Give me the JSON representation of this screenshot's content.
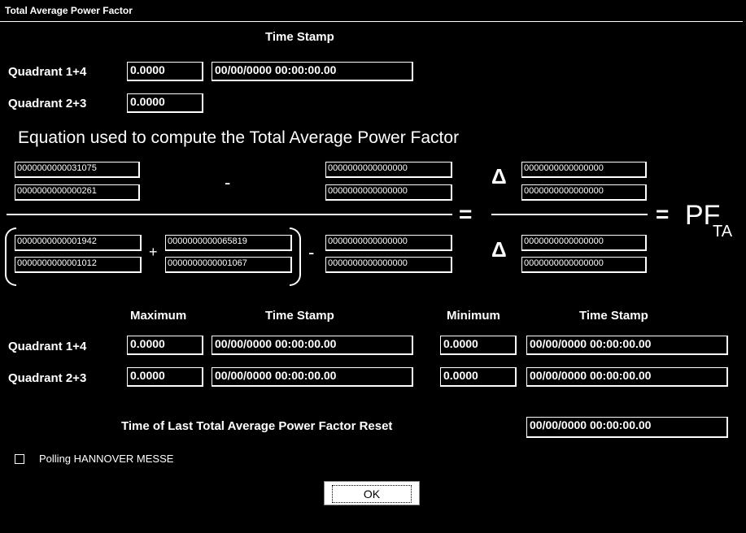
{
  "window": {
    "title": "Total Average Power Factor"
  },
  "top": {
    "time_stamp_header": "Time Stamp",
    "q14_label": "Quadrant 1+4",
    "q14_value": "0.0000",
    "q14_time": "00/00/0000 00:00:00.00",
    "q23_label": "Quadrant 2+3",
    "q23_value": "0.0000"
  },
  "equation": {
    "title": "Equation used to compute the Total Average Power Factor",
    "num_left_1": "0000000000031075",
    "num_left_2": "0000000000000261",
    "num_mid_1": "0000000000000000",
    "num_mid_2": "0000000000000000",
    "num_right_1": "0000000000000000",
    "num_right_2": "0000000000000000",
    "den_a_1": "0000000000001942",
    "den_a_2": "0000000000001012",
    "den_b_1": "0000000000065819",
    "den_b_2": "0000000000001067",
    "den_mid_1": "0000000000000000",
    "den_mid_2": "0000000000000000",
    "den_right_1": "0000000000000000",
    "den_right_2": "0000000000000000",
    "minus": "-",
    "plus": "+",
    "equals": "=",
    "delta": "Δ",
    "result_pf": "PF",
    "result_sub": "TA"
  },
  "extremes": {
    "maximum_header": "Maximum",
    "time_stamp_header_1": "Time Stamp",
    "minimum_header": "Minimum",
    "time_stamp_header_2": "Time Stamp",
    "q14_label": "Quadrant 1+4",
    "q23_label": "Quadrant 2+3",
    "q14_max": "0.0000",
    "q14_max_time": "00/00/0000 00:00:00.00",
    "q14_min": "0.0000",
    "q14_min_time": "00/00/0000 00:00:00.00",
    "q23_max": "0.0000",
    "q23_max_time": "00/00/0000 00:00:00.00",
    "q23_min": "0.0000",
    "q23_min_time": "00/00/0000 00:00:00.00"
  },
  "reset": {
    "label": "Time of Last Total Average Power Factor Reset",
    "value": "00/00/0000 00:00:00.00"
  },
  "polling": {
    "label": "Polling HANNOVER MESSE",
    "checked": false
  },
  "ok_label": "OK"
}
